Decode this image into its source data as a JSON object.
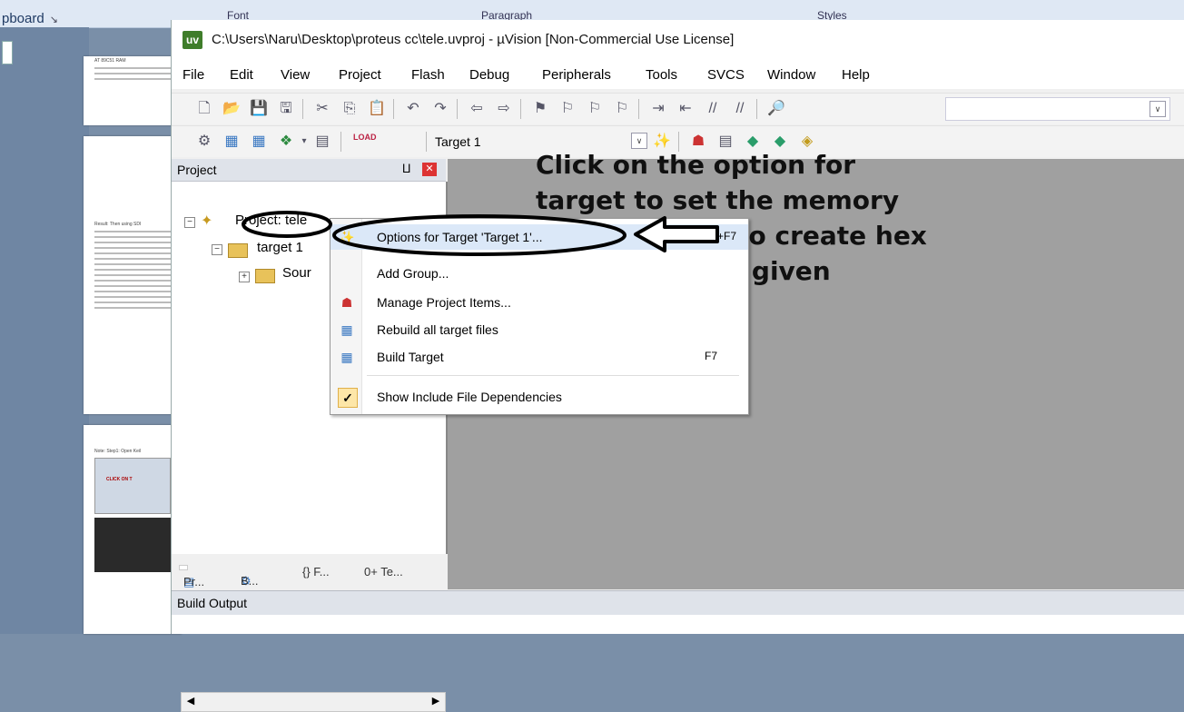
{
  "background": {
    "ribbon_clipboard": "pboard",
    "ribbon_font": "Font",
    "ribbon_paragraph": "Paragraph",
    "ribbon_styles": "Styles",
    "page1_text": "AT 89C51 RAM",
    "page2_text": "Result: Then using SDI",
    "page3_text": "Note: Step1: Open Keil",
    "page3_banner": "CLICK ON T"
  },
  "window": {
    "app_icon": "uv",
    "title": "C:\\Users\\Naru\\Desktop\\proteus cc\\tele.uvproj - µVision  [Non-Commercial Use License]"
  },
  "menu": [
    "File",
    "Edit",
    "View",
    "Project",
    "Flash",
    "Debug",
    "Peripherals",
    "Tools",
    "SVCS",
    "Window",
    "Help"
  ],
  "toolbar": {
    "target_combo": "Target 1",
    "load_label": "LOAD"
  },
  "project_panel": {
    "header": "Project",
    "pin_icon": "pin-icon",
    "root": "Project: tele",
    "target": "target 1",
    "source_group": "Sour"
  },
  "panel_tabs": [
    "Pr...",
    "B...",
    "{} F...",
    "0+ Te..."
  ],
  "build_output": {
    "header": "Build Output"
  },
  "context_menu": {
    "items": [
      {
        "label": "Options for Target 'Target 1'...",
        "shortcut": "Alt+F7",
        "icon": "magic-wand-icon",
        "highlighted": true
      },
      {
        "label": "Add Group...",
        "shortcut": "",
        "icon": "",
        "highlighted": false
      },
      {
        "label": "Manage Project Items...",
        "shortcut": "",
        "icon": "project-items-icon",
        "highlighted": false
      },
      {
        "label": "Rebuild all target files",
        "shortcut": "",
        "icon": "rebuild-icon",
        "highlighted": false
      },
      {
        "label": "Build Target",
        "shortcut": "F7",
        "icon": "build-icon",
        "highlighted": false
      },
      {
        "label": "Show Include File Dependencies",
        "shortcut": "",
        "icon": "check-icon",
        "highlighted": false
      }
    ]
  },
  "instruction": "Click on the option for target to set the memory configuration to create hex code base don given program",
  "colors": {
    "workspace": "#a0a0a0",
    "highlight": "#dbe8f8",
    "annotation": "#000000"
  }
}
